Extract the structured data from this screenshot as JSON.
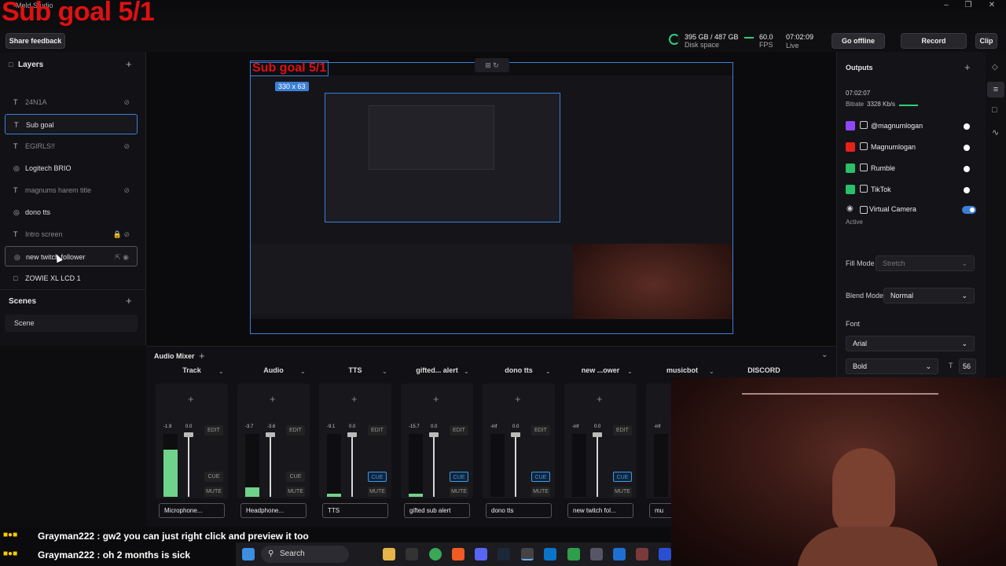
{
  "app": {
    "title": "Meld Studio"
  },
  "overlay": {
    "sub_goal": "Sub goal 5/1"
  },
  "topbar": {
    "feedback": "Share feedback",
    "disk_value": "395 GB / 487 GB",
    "disk_label": "Disk space",
    "fps_value": "60.0",
    "fps_label": "FPS",
    "time_value": "07:02:09",
    "time_label": "Live",
    "go_offline": "Go offline",
    "record": "Record",
    "clip": "Clip"
  },
  "layers": {
    "title": "Layers",
    "items": [
      {
        "label": "24N1A"
      },
      {
        "label": "Sub goal"
      },
      {
        "label": "EGIRLS!!"
      },
      {
        "label": "Logitech BRIO"
      },
      {
        "label": "magnums harem title"
      },
      {
        "label": "dono tts"
      },
      {
        "label": "Intro screen"
      },
      {
        "label": "new twitch follower"
      },
      {
        "label": "ZOWIE XL LCD 1"
      }
    ]
  },
  "scenes": {
    "title": "Scenes",
    "items": [
      {
        "label": "Scene"
      }
    ]
  },
  "preview": {
    "size_badge": "330 x 63"
  },
  "outputs": {
    "title": "Outputs",
    "live_time": "07:02:07",
    "bitrate_label": "Bitrate",
    "bitrate_value": "3328 Kb/s",
    "items": [
      {
        "label": "@magnumlogan",
        "color": "#9146ff"
      },
      {
        "label": "Magnumlogan",
        "color": "#e62117"
      },
      {
        "label": "Rumble",
        "color": "#2bbf6a"
      },
      {
        "label": "TikTok",
        "color": "#2bbf6a"
      }
    ],
    "virtual_camera": "Virtual Camera",
    "virtual_status": "Active"
  },
  "props": {
    "fill_mode_label": "Fill Mode",
    "fill_mode": "Stretch",
    "blend_mode_label": "Blend Mode",
    "blend_mode": "Normal",
    "font_label": "Font",
    "font": "Arial",
    "weight": "Bold",
    "size": "56"
  },
  "mixer": {
    "title": "Audio Mixer",
    "edit": "EDIT",
    "cue": "CUE",
    "mute": "MUTE",
    "tracks": [
      {
        "name": "Track",
        "src": "Microphone...",
        "db1": "-1.9",
        "db2": "0.0",
        "level": 0.75,
        "cue_on": false
      },
      {
        "name": "Audio",
        "src": "Headphone...",
        "db1": "-3.7",
        "db2": "-3.6",
        "level": 0.15,
        "cue_on": false
      },
      {
        "name": "TTS",
        "src": "TTS",
        "db1": "-9.1",
        "db2": "0.0",
        "level": 0.05,
        "cue_on": true
      },
      {
        "name": "gifted... alert",
        "src": "gifted sub alert",
        "db1": "-15.7",
        "db2": "0.0",
        "level": 0.05,
        "cue_on": true
      },
      {
        "name": "dono tts",
        "src": "dono tts",
        "db1": "-inf",
        "db2": "0.0",
        "level": 0.0,
        "cue_on": true
      },
      {
        "name": "new ...ower",
        "src": "new twitch fol...",
        "db1": "-inf",
        "db2": "0.0",
        "level": 0.0,
        "cue_on": true
      },
      {
        "name": "musicbot",
        "src": "mu",
        "db1": "-inf",
        "db2": "",
        "level": 0.0,
        "cue_on": false
      }
    ],
    "discord": "DISCORD"
  },
  "chat": {
    "line1": "Grayman222 : gw2 you can just right click and preview it too",
    "line2": "Grayman222 : oh 2 months is sick"
  },
  "taskbar": {
    "search": "Search"
  }
}
